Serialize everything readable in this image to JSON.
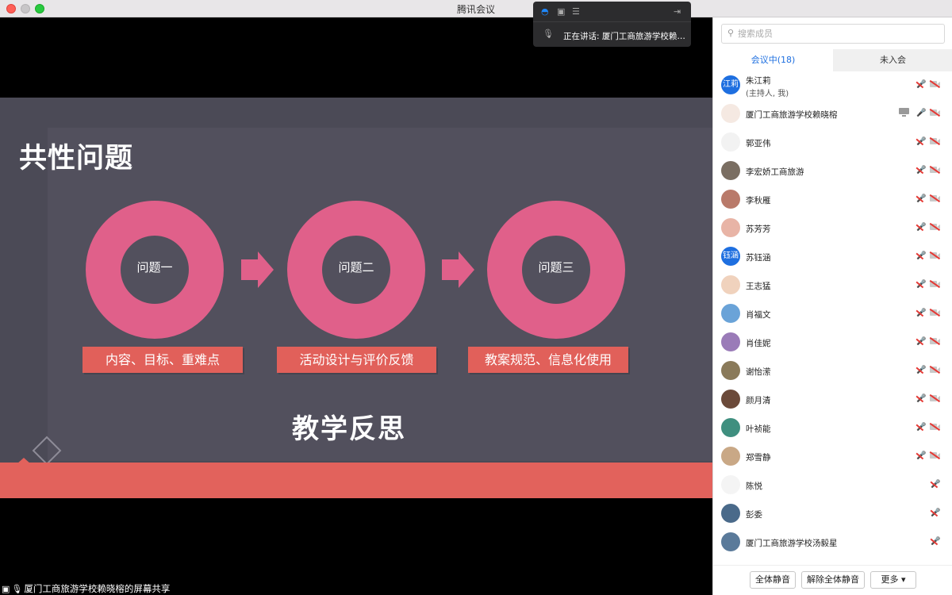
{
  "window": {
    "title": "腾讯会议"
  },
  "slide": {
    "title": "共性问题",
    "rings": [
      "问题一",
      "问题二",
      "问题三"
    ],
    "tags": [
      "内容、目标、重难点",
      "活动设计与评价反馈",
      "教案规范、信息化使用"
    ],
    "subtitle": "教学反思"
  },
  "speaking": {
    "text": "正在讲话: 厦门工商旅游学校赖晓榕"
  },
  "share_label": "厦门工商旅游学校赖晓榕的屏幕共享",
  "sidebar": {
    "search_placeholder": "搜索成员",
    "tabs": {
      "in_meeting": "会议中(18)",
      "not_joined": "未入会"
    },
    "members": [
      {
        "name": "朱江莉",
        "sub": "(主持人, 我)",
        "avatar_text": "江莉",
        "avatar_color": "#1e6fe0"
      },
      {
        "name": "厦门工商旅游学校赖晓榕",
        "avatar_color": "#f5e9e2"
      },
      {
        "name": "郭亚伟",
        "avatar_color": "#f2f2f2"
      },
      {
        "name": "李宏娇工商旅游",
        "avatar_color": "#7a6e62"
      },
      {
        "name": "李秋雁",
        "avatar_color": "#b97a6a"
      },
      {
        "name": "苏芳芳",
        "avatar_color": "#e8b4a6"
      },
      {
        "name": "苏钰涵",
        "avatar_text": "钰涵",
        "avatar_color": "#1e6fe0"
      },
      {
        "name": "王志猛",
        "avatar_color": "#f0d2bd"
      },
      {
        "name": "肖福文",
        "avatar_color": "#6aa3d8"
      },
      {
        "name": "肖佳妮",
        "avatar_color": "#9a7bb8"
      },
      {
        "name": "谢怡潆",
        "avatar_color": "#8a7a5a"
      },
      {
        "name": "颜月清",
        "avatar_color": "#6b4a3a"
      },
      {
        "name": "叶祯能",
        "avatar_color": "#3f8f7f"
      },
      {
        "name": "郑雪静",
        "avatar_color": "#c9a886"
      },
      {
        "name": "陈悦",
        "avatar_color": "#f4f4f4"
      },
      {
        "name": "彭委",
        "avatar_color": "#4a6a8a"
      },
      {
        "name": "厦门工商旅游学校汤毅星",
        "avatar_color": "#5a7a9a"
      }
    ],
    "buttons": {
      "mute_all": "全体静音",
      "unmute_all": "解除全体静音",
      "more": "更多 ▾"
    }
  }
}
